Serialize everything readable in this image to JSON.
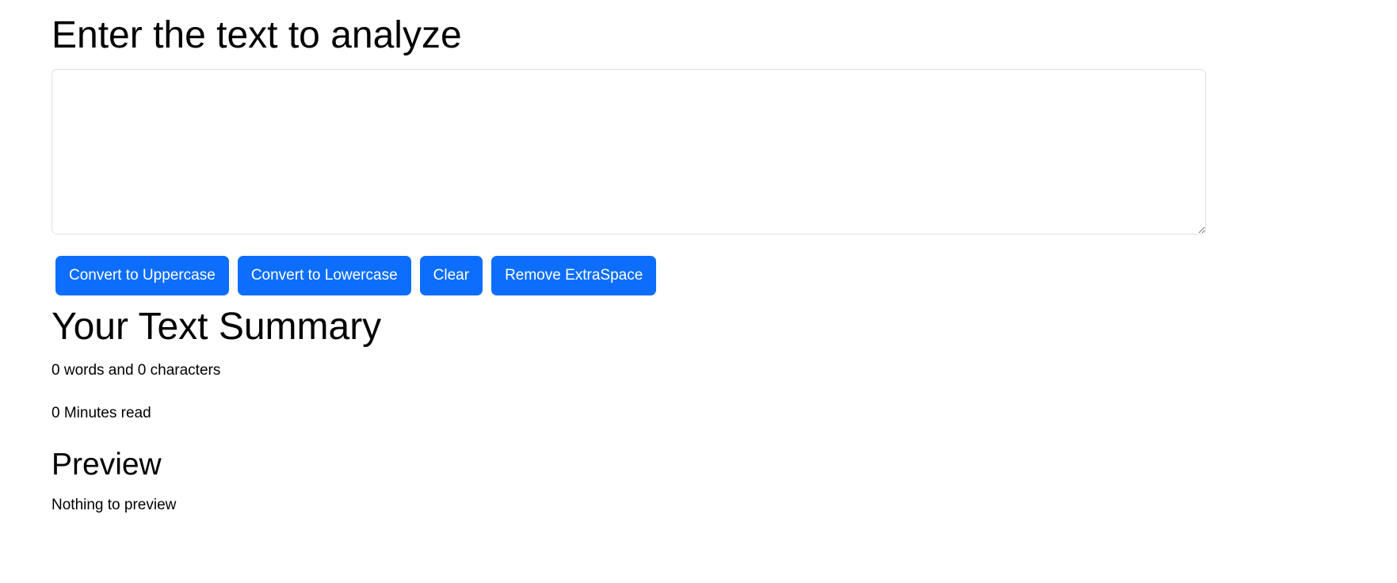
{
  "heading": "Enter the text to analyze",
  "textarea": {
    "value": "",
    "placeholder": ""
  },
  "buttons": {
    "uppercase": "Convert to Uppercase",
    "lowercase": "Convert to Lowercase",
    "clear": "Clear",
    "remove_extra_space": "Remove ExtraSpace"
  },
  "summary": {
    "title": "Your Text Summary",
    "counts": "0 words and 0 characters",
    "read_time": "0 Minutes read"
  },
  "preview": {
    "title": "Preview",
    "text": "Nothing to preview"
  },
  "colors": {
    "primary": "#0d6efd"
  }
}
